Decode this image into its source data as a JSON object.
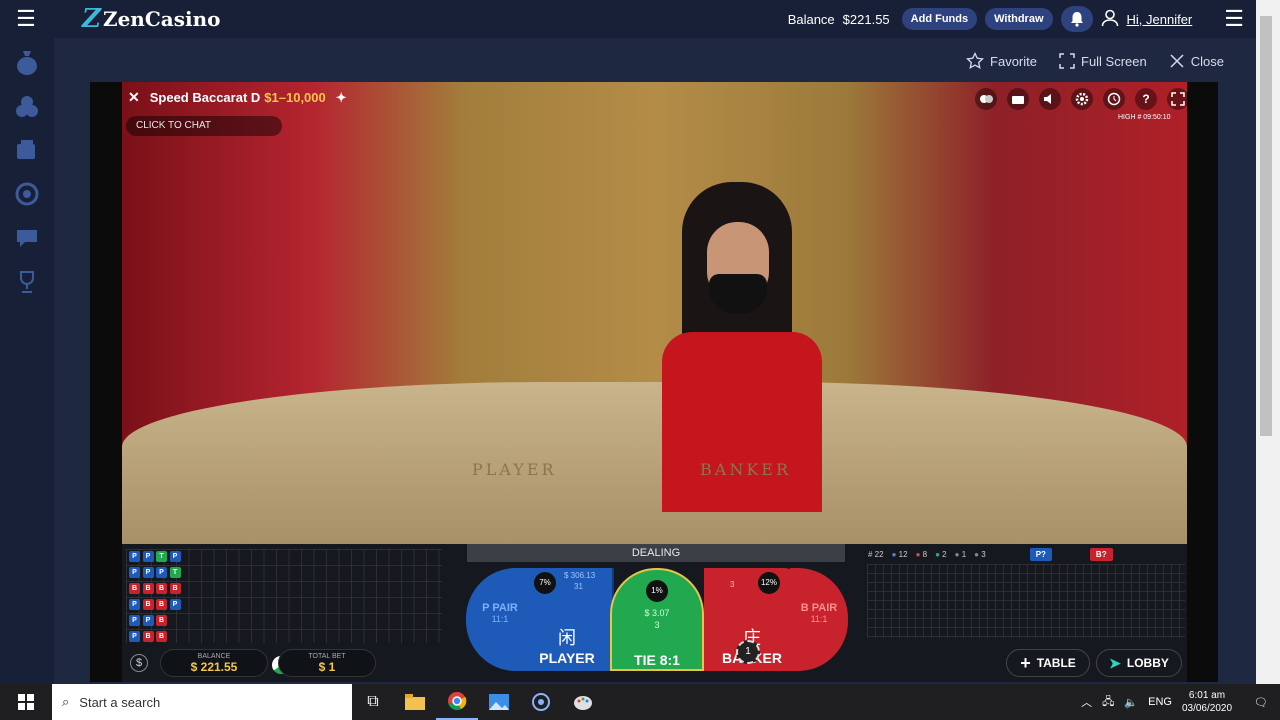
{
  "header": {
    "brand": "ZenCasino",
    "balance_label": "Balance",
    "balance_value": "$221.55",
    "add_funds": "Add Funds",
    "withdraw": "Withdraw",
    "greeting": "Hi, Jennifer"
  },
  "sidebar": {
    "items": [
      "money-bag-icon",
      "poker-chips-icon",
      "slot-machine-icon",
      "live-casino-icon",
      "chat-help-icon",
      "trophy-icon"
    ]
  },
  "actions": {
    "favorite": "Favorite",
    "fullscreen": "Full Screen",
    "close": "Close"
  },
  "game": {
    "name": "Speed Baccarat D",
    "limits": "$1–10,000",
    "chat": "CLICK TO CHAT",
    "quality": "HIGH",
    "timer": "# 09:50:10",
    "status": "DEALING",
    "table_player_label": "PLAYER",
    "table_banker_label": "BANKER",
    "balance_label": "BALANCE",
    "balance_value": "$ 221.55",
    "totalbet_label": "TOTAL BET",
    "totalbet_value": "$ 1",
    "bets": {
      "ppair_label": "P PAIR",
      "ppair_odds": "11:1",
      "player_pct": "7%",
      "player_amount": "$ 306.13",
      "player_count": "31",
      "player_cn": "闲",
      "player_label": "PLAYER",
      "tie_pct": "1%",
      "tie_amount": "$ 3.07",
      "tie_count": "3",
      "tie_label": "TIE 8:1",
      "banker_pct": "12%",
      "banker_count": "3",
      "banker_cn": "庄",
      "banker_label": "BANKER",
      "banker_chip": "1",
      "bpair_label": "B PAIR",
      "bpair_odds": "11:1"
    },
    "stats": {
      "rounds": "# 22",
      "p": "12",
      "b": "8",
      "t": "2",
      "pp": "1",
      "bp": "3",
      "p_q": "P?",
      "b_q": "B?"
    },
    "bead_road": [
      [
        "P",
        "P",
        "T",
        "P"
      ],
      [
        "P",
        "P",
        "P",
        "T"
      ],
      [
        "B",
        "B",
        "B",
        "B"
      ],
      [
        "P",
        "B",
        "B",
        "P"
      ],
      [
        "P",
        "P",
        "B"
      ],
      [
        "P",
        "B",
        "B"
      ]
    ],
    "table_btn": "TABLE",
    "lobby_btn": "LOBBY"
  },
  "colors": {
    "player": "#1e5bb8",
    "banker": "#c8232c",
    "tie": "#22a94f",
    "brand": "#2f4280",
    "gold": "#f3c64c"
  },
  "taskbar": {
    "search": "Start a search",
    "lang": "ENG",
    "time": "6:01 am",
    "date": "03/06/2020"
  }
}
